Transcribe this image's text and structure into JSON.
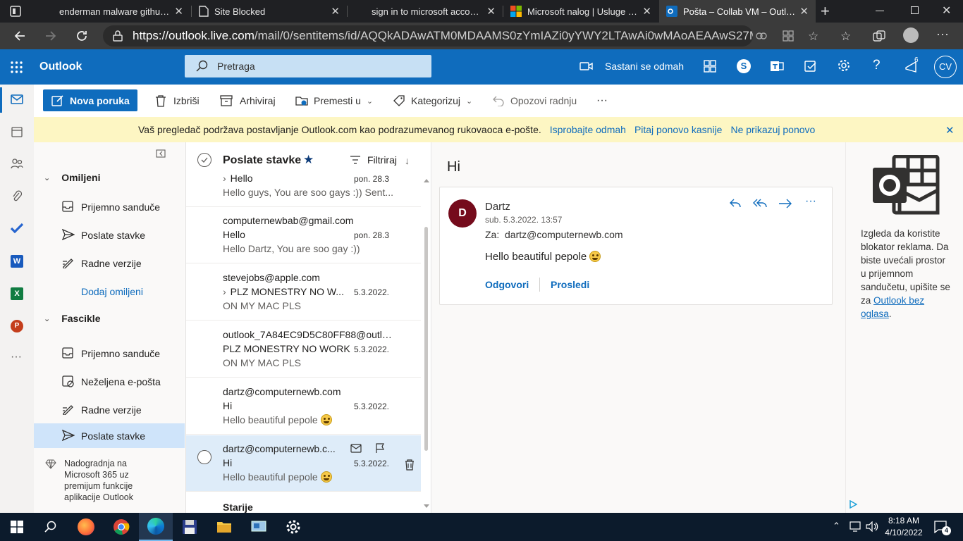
{
  "browser": {
    "tabs": [
      {
        "title": "enderman malware github -",
        "active": false
      },
      {
        "title": "Site Blocked",
        "active": false
      },
      {
        "title": "sign in to microsoft account",
        "active": false
      },
      {
        "title": "Microsoft nalog | Usluge i pr",
        "active": false
      },
      {
        "title": "Pošta – Collab VM – Outlook",
        "active": true
      }
    ],
    "url_prefix": "https://",
    "url_domain": "outlook.live.com",
    "url_path": "/mail/0/sentitems/id/AQQkADAwATM0MDAAMS0zYmIAZi0yYWY2LTAwAi0wMAoAEAAwS27MQ..."
  },
  "header": {
    "app_name": "Outlook",
    "search_placeholder": "Pretraga",
    "meet_now": "Sastani se odmah",
    "notif_count": "6",
    "avatar_initials": "CV"
  },
  "commands": {
    "new_message": "Nova poruka",
    "delete": "Izbriši",
    "archive": "Arhiviraj",
    "move_to": "Premesti u",
    "categorize": "Kategorizuj",
    "undo": "Opozovi radnju",
    "more": "···"
  },
  "banner": {
    "text": "Vaš pregledač podržava postavljanje Outlook.com kao podrazumevanog rukovaoca e-pošte.",
    "try_now": "Isprobajte odmah",
    "ask_later": "Pitaj ponovo kasnije",
    "dont_show": "Ne prikazuj ponovo"
  },
  "folders": {
    "favorites_label": "Omiljeni",
    "favorites": [
      "Prijemno sanduče",
      "Poslate stavke",
      "Radne verzije"
    ],
    "add_favorite": "Dodaj omiljeni",
    "folders_label": "Fascikle",
    "items": [
      "Prijemno sanduče",
      "Neželjena e-pošta",
      "Radne verzije",
      "Poslate stavke"
    ],
    "upgrade_text": "Nadogradnja na Microsoft 365 uz premijum funkcije aplikacije Outlook"
  },
  "list": {
    "title": "Poslate stavke",
    "filter": "Filtriraj",
    "section_older": "Starije",
    "messages": [
      {
        "sender": "",
        "subject": "Hello",
        "preview": "Hello guys, You are soo gays :)) Sent...",
        "date": "pon. 28.3"
      },
      {
        "sender": "computernewbab@gmail.com",
        "subject": "Hello",
        "preview": "Hello Dartz, You are soo gay :))",
        "date": "pon. 28.3"
      },
      {
        "sender": "stevejobs@apple.com",
        "subject": "PLZ MONESTRY NO W...",
        "preview": "ON MY MAC PLS",
        "date": "5.3.2022."
      },
      {
        "sender": "outlook_7A84EC9D5C80FF88@outlo...",
        "subject": "PLZ MONESTRY NO WORK",
        "preview": "ON MY MAC PLS",
        "date": "5.3.2022."
      },
      {
        "sender": "dartz@computernewb.com",
        "subject": "Hi",
        "preview": "Hello beautiful pepole",
        "date": "5.3.2022."
      },
      {
        "sender": "dartz@computernewb.c...",
        "subject": "Hi",
        "preview": "Hello beautiful pepole",
        "date": "5.3.2022."
      }
    ]
  },
  "reading": {
    "subject": "Hi",
    "sender_name": "Dartz",
    "sender_initial": "D",
    "date": "sub. 5.3.2022. 13:57",
    "to_label": "Za:",
    "to_address": "dartz@computernewb.com",
    "body": "Hello beautiful pepole",
    "reply": "Odgovori",
    "forward": "Prosledi"
  },
  "ad": {
    "text": "Izgleda da koristite blokator reklama. Da biste uvećali prostor u prijemnom sandučetu, upišite se za",
    "link": "Outlook bez oglasa",
    "period": "."
  },
  "taskbar": {
    "time": "8:18 AM",
    "date": "4/10/2022",
    "notif_count": "4"
  },
  "colors": {
    "brand": "#0f6cbd",
    "selected_folder": "#cfe4fa",
    "selected_row": "#deecf9",
    "avatar": "#750b1c"
  }
}
